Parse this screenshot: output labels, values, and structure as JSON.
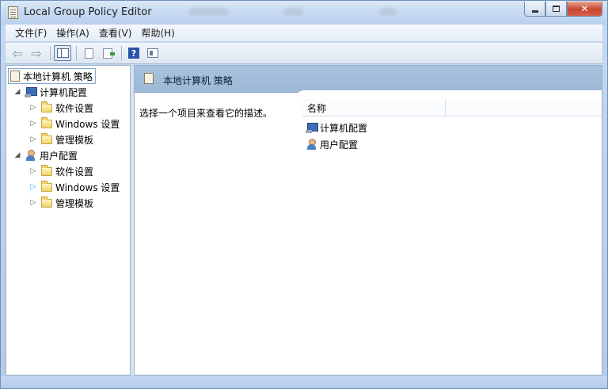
{
  "window": {
    "title": "Local Group Policy Editor",
    "close_glyph": "✕"
  },
  "menu": [
    {
      "label": "文件(F)"
    },
    {
      "label": "操作(A)"
    },
    {
      "label": "查看(V)"
    },
    {
      "label": "帮助(H)"
    }
  ],
  "toolbar": {
    "back_glyph": "⇦",
    "forward_glyph": "⇨",
    "help_glyph": "?"
  },
  "tree": {
    "root": "本地计算机 策略",
    "computer_config": "计算机配置",
    "computer_children": [
      "软件设置",
      "Windows 设置",
      "管理模板"
    ],
    "user_config": "用户配置",
    "user_children": [
      "软件设置",
      "Windows 设置",
      "管理模板"
    ],
    "expanded_glyph": "◢",
    "collapsed_glyph": "▷"
  },
  "right_pane": {
    "title": "本地计算机 策略",
    "description": "选择一个项目来查看它的描述。",
    "column_name": "名称",
    "items": [
      "计算机配置",
      "用户配置"
    ]
  },
  "icons": {
    "app": "policy-doc-icon",
    "computer": "computer-icon",
    "user": "user-icon",
    "folder": "folder-icon"
  },
  "colors": {
    "titlebar": "#c6daf2",
    "header_band": "#a9c2df",
    "close_button": "#c7472f"
  }
}
